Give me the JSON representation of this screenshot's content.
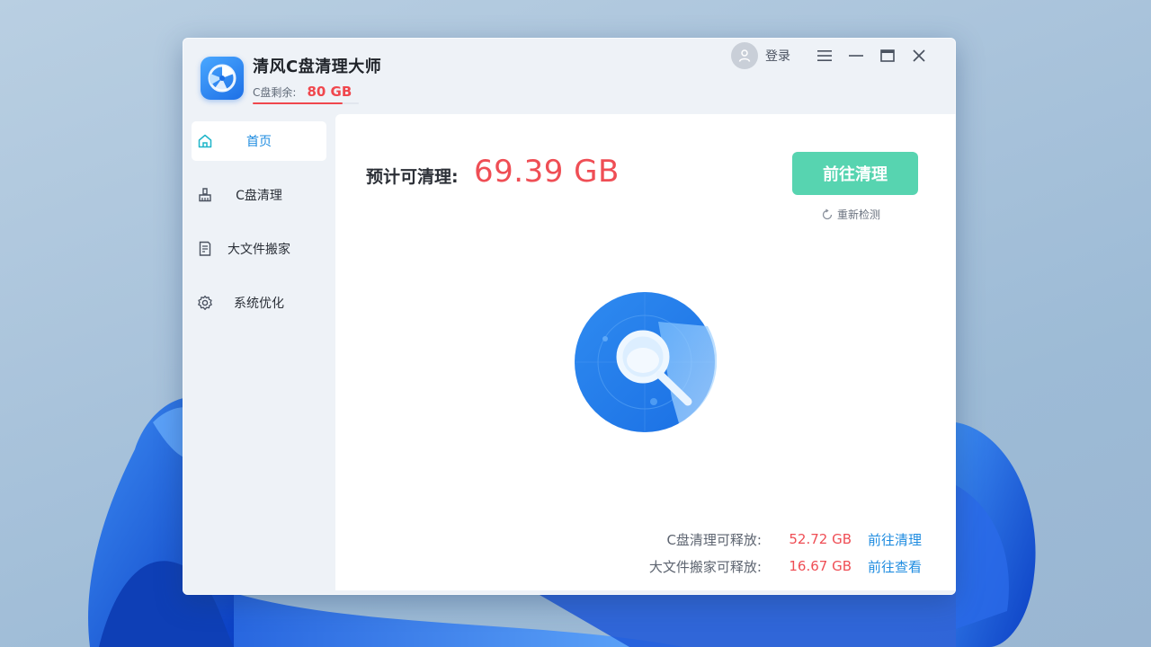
{
  "app": {
    "title": "清风C盘清理大师",
    "remaining_label": "C盘剩余:",
    "remaining_value": "80 GB",
    "remaining_fraction": 0.85
  },
  "titlebar": {
    "login_label": "登录",
    "buttons": [
      "menu-icon",
      "minimize-icon",
      "maximize-icon",
      "close-icon"
    ]
  },
  "sidebar": {
    "items": [
      {
        "label": "首页",
        "icon": "home-icon",
        "active": true
      },
      {
        "label": "C盘清理",
        "icon": "broom-icon",
        "active": false
      },
      {
        "label": "大文件搬家",
        "icon": "document-icon",
        "active": false
      },
      {
        "label": "系统优化",
        "icon": "gear-icon",
        "active": false
      }
    ]
  },
  "main": {
    "estimate_label": "预计可清理:",
    "estimate_value": "69.39 GB",
    "clean_button": "前往清理",
    "recheck_label": "重新检测",
    "release": [
      {
        "label": "C盘清理可释放:",
        "value": "52.72 GB",
        "link": "前往清理"
      },
      {
        "label": "大文件搬家可释放:",
        "value": "16.67 GB",
        "link": "前往查看"
      }
    ]
  },
  "colors": {
    "accent": "#1f8ce0",
    "danger": "#ef4e55",
    "button": "#57d4b0"
  }
}
